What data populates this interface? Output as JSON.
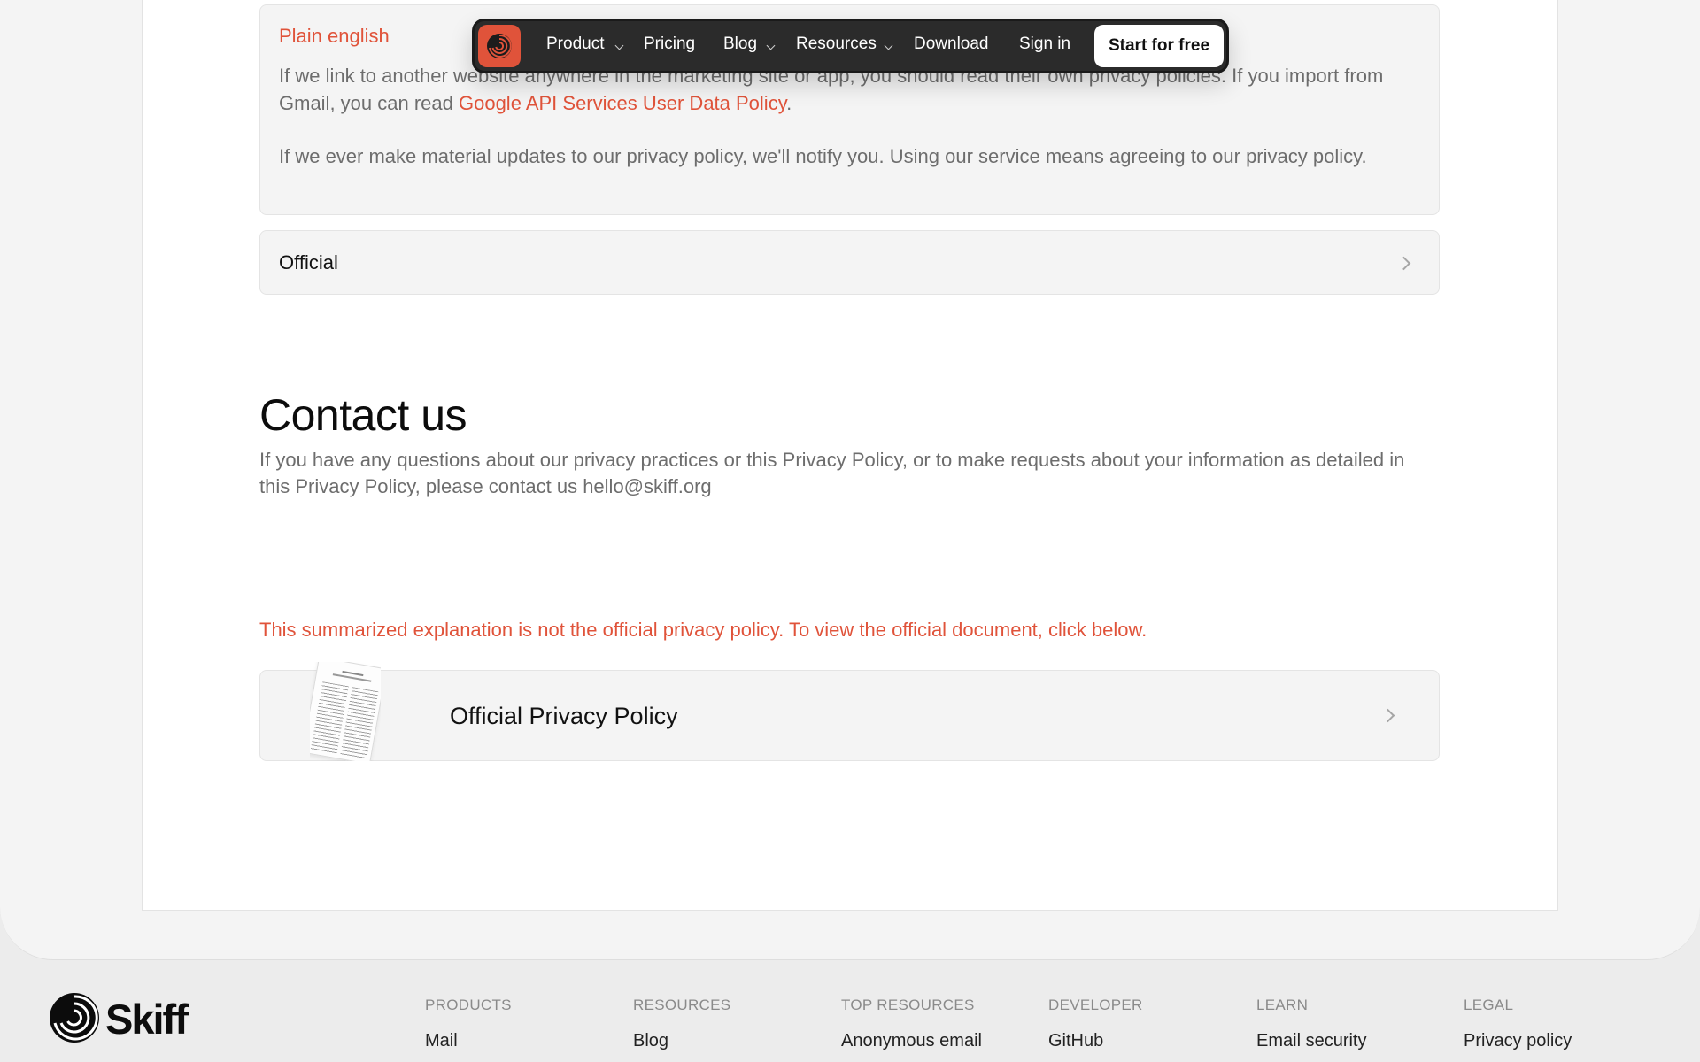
{
  "accordion_plain": {
    "label": "Plain english",
    "para1_before": "If we link to another website anywhere in the marketing site or app, you should read their own privacy policies. If you import from Gmail, you can read ",
    "para1_link": "Google API Services User Data Policy",
    "para1_after": ".",
    "para2": "If we ever make material updates to our privacy policy, we'll notify you. Using our service means agreeing to our privacy policy."
  },
  "accordion_official": {
    "label": "Official"
  },
  "contact": {
    "title": "Contact us",
    "text": "If you have any questions about our privacy practices or this Privacy Policy, or to make requests about your information as detailed in this Privacy Policy, please contact us hello@skiff.org"
  },
  "notice": "This summarized explanation is not the official privacy policy. To view the official document, click below.",
  "policy_card": {
    "label": "Official Privacy Policy"
  },
  "nav": {
    "product": "Product",
    "pricing": "Pricing",
    "blog": "Blog",
    "resources": "Resources",
    "download": "Download",
    "sign_in": "Sign in",
    "cta": "Start for free"
  },
  "footer": {
    "brand": "Skiff",
    "columns": [
      {
        "heading": "PRODUCTS",
        "item": "Mail"
      },
      {
        "heading": "RESOURCES",
        "item": "Blog"
      },
      {
        "heading": "TOP RESOURCES",
        "item": "Anonymous email"
      },
      {
        "heading": "DEVELOPER",
        "item": "GitHub"
      },
      {
        "heading": "LEARN",
        "item": "Email security"
      },
      {
        "heading": "LEGAL",
        "item": "Privacy policy"
      }
    ]
  },
  "colors": {
    "accent": "#e0533a",
    "nav_bg": "#2b2b2b",
    "page_bg": "#f4f4f4",
    "footer_bg": "#ececec"
  },
  "icons": {
    "logo": "skiff-swirl-icon",
    "dropdown": "chevron-down-icon",
    "expand": "chevron-right-icon",
    "document": "document-thumbnail"
  }
}
